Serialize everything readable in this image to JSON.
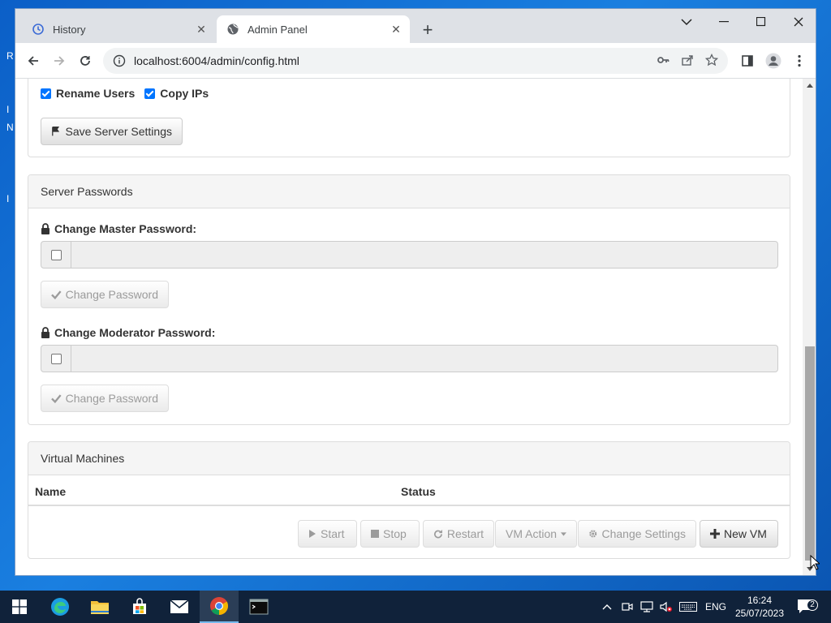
{
  "tabs": [
    {
      "title": "History",
      "icon": "history-icon"
    },
    {
      "title": "Admin Panel",
      "icon": "globe-icon"
    }
  ],
  "address_bar": {
    "url": "localhost:6004/admin/config.html"
  },
  "server_settings": {
    "permissions": [
      {
        "label": "Rename Users",
        "checked": true
      },
      {
        "label": "Copy IPs",
        "checked": true
      }
    ],
    "save_label": "Save Server Settings"
  },
  "server_passwords": {
    "heading": "Server Passwords",
    "master": {
      "label": "Change Master Password:",
      "value": "",
      "enabled": false,
      "button": "Change Password"
    },
    "moderator": {
      "label": "Change Moderator Password:",
      "value": "",
      "enabled": false,
      "button": "Change Password"
    }
  },
  "virtual_machines": {
    "heading": "Virtual Machines",
    "columns": [
      "Name",
      "Status"
    ],
    "rows": [],
    "actions": {
      "start": "Start",
      "stop": "Stop",
      "restart": "Restart",
      "vm_action": "VM Action",
      "change_settings": "Change Settings",
      "new_vm": "New VM"
    }
  },
  "taskbar": {
    "language": "ENG",
    "time": "16:24",
    "date": "25/07/2023",
    "notifications": "2"
  },
  "colors": {
    "checkbox_accent": "#0075ff",
    "taskbar": "#10223a",
    "desktop": "#1a7fe0"
  }
}
